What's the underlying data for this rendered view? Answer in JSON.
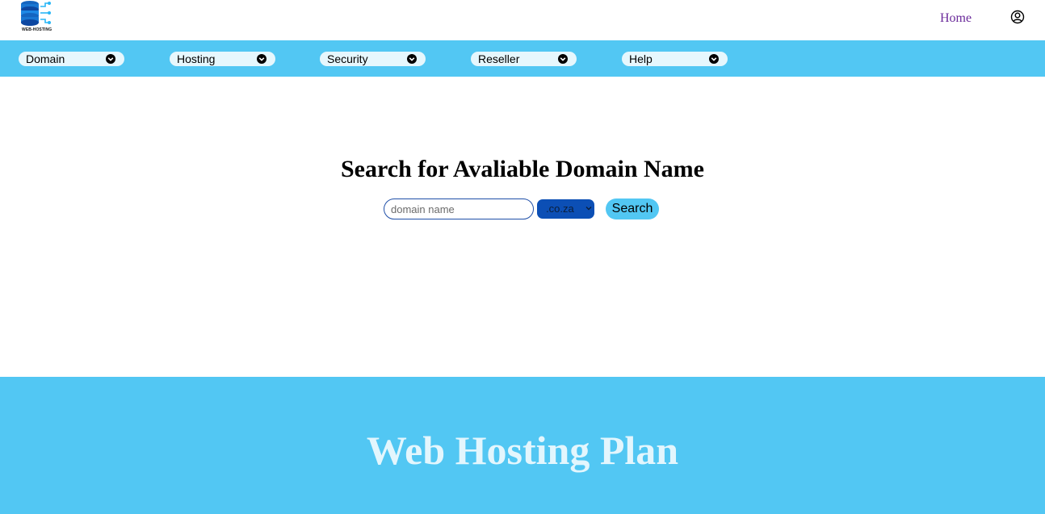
{
  "header": {
    "logo_text": "WEB-HOSTING",
    "home_label": "Home"
  },
  "nav": {
    "items": [
      {
        "label": "Domain"
      },
      {
        "label": "Hosting"
      },
      {
        "label": "Security"
      },
      {
        "label": "Reseller"
      },
      {
        "label": "Help"
      }
    ]
  },
  "search": {
    "title": "Search for Avaliable Domain Name",
    "input_placeholder": "domain name",
    "input_value": "",
    "tld_selected": ".co.za",
    "button_label": "Search"
  },
  "plans": {
    "title": "Web Hosting Plan"
  },
  "colors": {
    "accent": "#52c7f3",
    "nav_item_bg": "#e6f7fd",
    "tld_bg": "#0c4fb5",
    "home_link": "#6a2a9a",
    "plan_title": "#e3f6fd"
  },
  "icons": {
    "logo": "database-network-icon",
    "user": "user-circle-icon",
    "chevron": "chevron-down-circle-icon"
  }
}
